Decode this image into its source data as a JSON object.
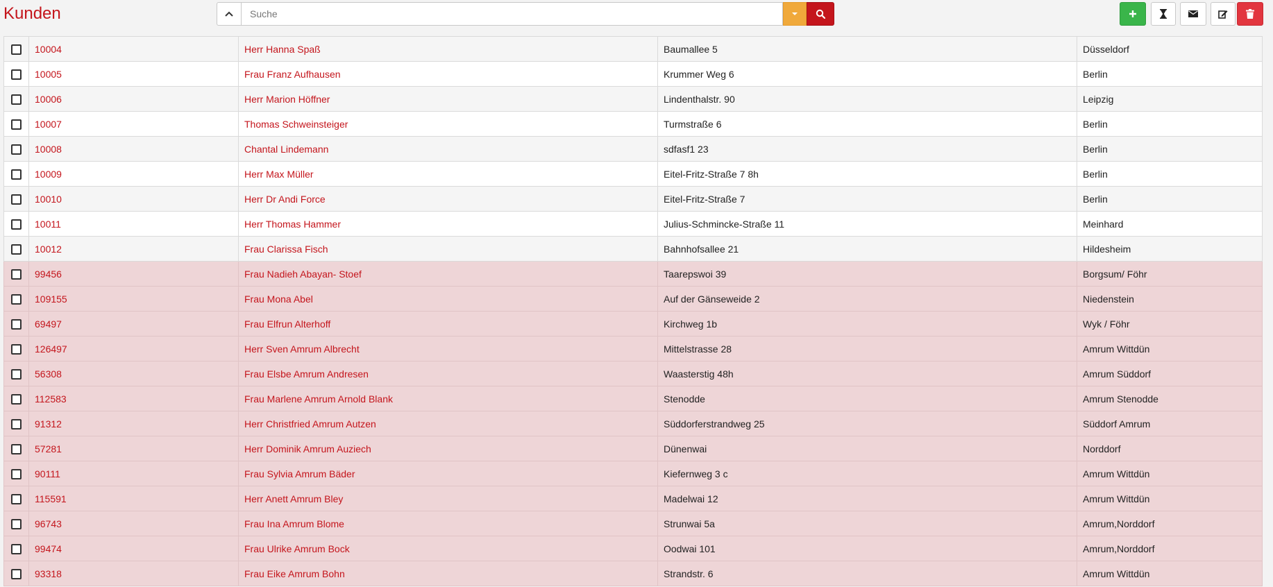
{
  "header": {
    "title": "Kunden",
    "search_placeholder": "Suche"
  },
  "colors": {
    "accent": "#c4151c",
    "add_button": "#3ab54a",
    "dropdown_button": "#f0a93b",
    "delete_button": "#e2363f",
    "highlight_row": "#eed5d7"
  },
  "icons": {
    "collapse": "chevron-up-icon",
    "dropdown": "caret-down-icon",
    "search": "search-icon",
    "add": "plus-icon",
    "hourglass": "hourglass-icon",
    "mail": "envelope-icon",
    "edit": "edit-icon",
    "delete": "trash-icon"
  },
  "customers": [
    {
      "id": "10004",
      "name": "Herr Hanna Spaß",
      "street": "Baumallee 5",
      "city": "Düsseldorf",
      "style": "gray"
    },
    {
      "id": "10005",
      "name": "Frau Franz Aufhausen",
      "street": "Krummer Weg 6",
      "city": "Berlin",
      "style": "white"
    },
    {
      "id": "10006",
      "name": "Herr Marion Höffner",
      "street": "Lindenthalstr. 90",
      "city": "Leipzig",
      "style": "gray"
    },
    {
      "id": "10007",
      "name": "Thomas Schweinsteiger",
      "street": "Turmstraße 6",
      "city": "Berlin",
      "style": "white"
    },
    {
      "id": "10008",
      "name": "Chantal Lindemann",
      "street": "sdfasf1 23",
      "city": "Berlin",
      "style": "gray"
    },
    {
      "id": "10009",
      "name": "Herr Max Müller",
      "street": "Eitel-Fritz-Straße 7 8h",
      "city": "Berlin",
      "style": "white"
    },
    {
      "id": "10010",
      "name": "Herr Dr Andi Force",
      "street": "Eitel-Fritz-Straße 7",
      "city": "Berlin",
      "style": "gray"
    },
    {
      "id": "10011",
      "name": "Herr Thomas Hammer",
      "street": "Julius-Schmincke-Straße 11",
      "city": "Meinhard",
      "style": "white"
    },
    {
      "id": "10012",
      "name": "Frau Clarissa Fisch",
      "street": "Bahnhofsallee 21",
      "city": "Hildesheim",
      "style": "gray"
    },
    {
      "id": "99456",
      "name": "Frau Nadieh Abayan- Stoef",
      "street": "Taarepswoi 39",
      "city": "Borgsum/ Föhr",
      "style": "pink"
    },
    {
      "id": "109155",
      "name": "Frau Mona Abel",
      "street": "Auf der Gänseweide 2",
      "city": "Niedenstein",
      "style": "pink"
    },
    {
      "id": "69497",
      "name": "Frau Elfrun Alterhoff",
      "street": "Kirchweg 1b",
      "city": "Wyk / Föhr",
      "style": "pink"
    },
    {
      "id": "126497",
      "name": "Herr Sven Amrum Albrecht",
      "street": "Mittelstrasse 28",
      "city": "Amrum Wittdün",
      "style": "pink"
    },
    {
      "id": "56308",
      "name": "Frau Elsbe Amrum Andresen",
      "street": "Waasterstig 48h",
      "city": "Amrum Süddorf",
      "style": "pink"
    },
    {
      "id": "112583",
      "name": "Frau Marlene Amrum Arnold Blank",
      "street": "Stenodde",
      "city": "Amrum Stenodde",
      "style": "pink"
    },
    {
      "id": "91312",
      "name": "Herr Christfried Amrum Autzen",
      "street": "Süddorferstrandweg 25",
      "city": "Süddorf Amrum",
      "style": "pink"
    },
    {
      "id": "57281",
      "name": "Herr Dominik Amrum Auziech",
      "street": "Dünenwai",
      "city": "Norddorf",
      "style": "pink"
    },
    {
      "id": "90111",
      "name": "Frau Sylvia Amrum Bäder",
      "street": "Kiefernweg 3 c",
      "city": "Amrum Wittdün",
      "style": "pink"
    },
    {
      "id": "115591",
      "name": "Herr Anett Amrum Bley",
      "street": "Madelwai 12",
      "city": "Amrum Wittdün",
      "style": "pink"
    },
    {
      "id": "96743",
      "name": "Frau Ina Amrum Blome",
      "street": "Strunwai 5a",
      "city": "Amrum,Norddorf",
      "style": "pink"
    },
    {
      "id": "99474",
      "name": "Frau Ulrike Amrum Bock",
      "street": "Oodwai 101",
      "city": "Amrum,Norddorf",
      "style": "pink"
    },
    {
      "id": "93318",
      "name": "Frau Eike Amrum Bohn",
      "street": "Strandstr. 6",
      "city": "Amrum Wittdün",
      "style": "pink"
    }
  ]
}
